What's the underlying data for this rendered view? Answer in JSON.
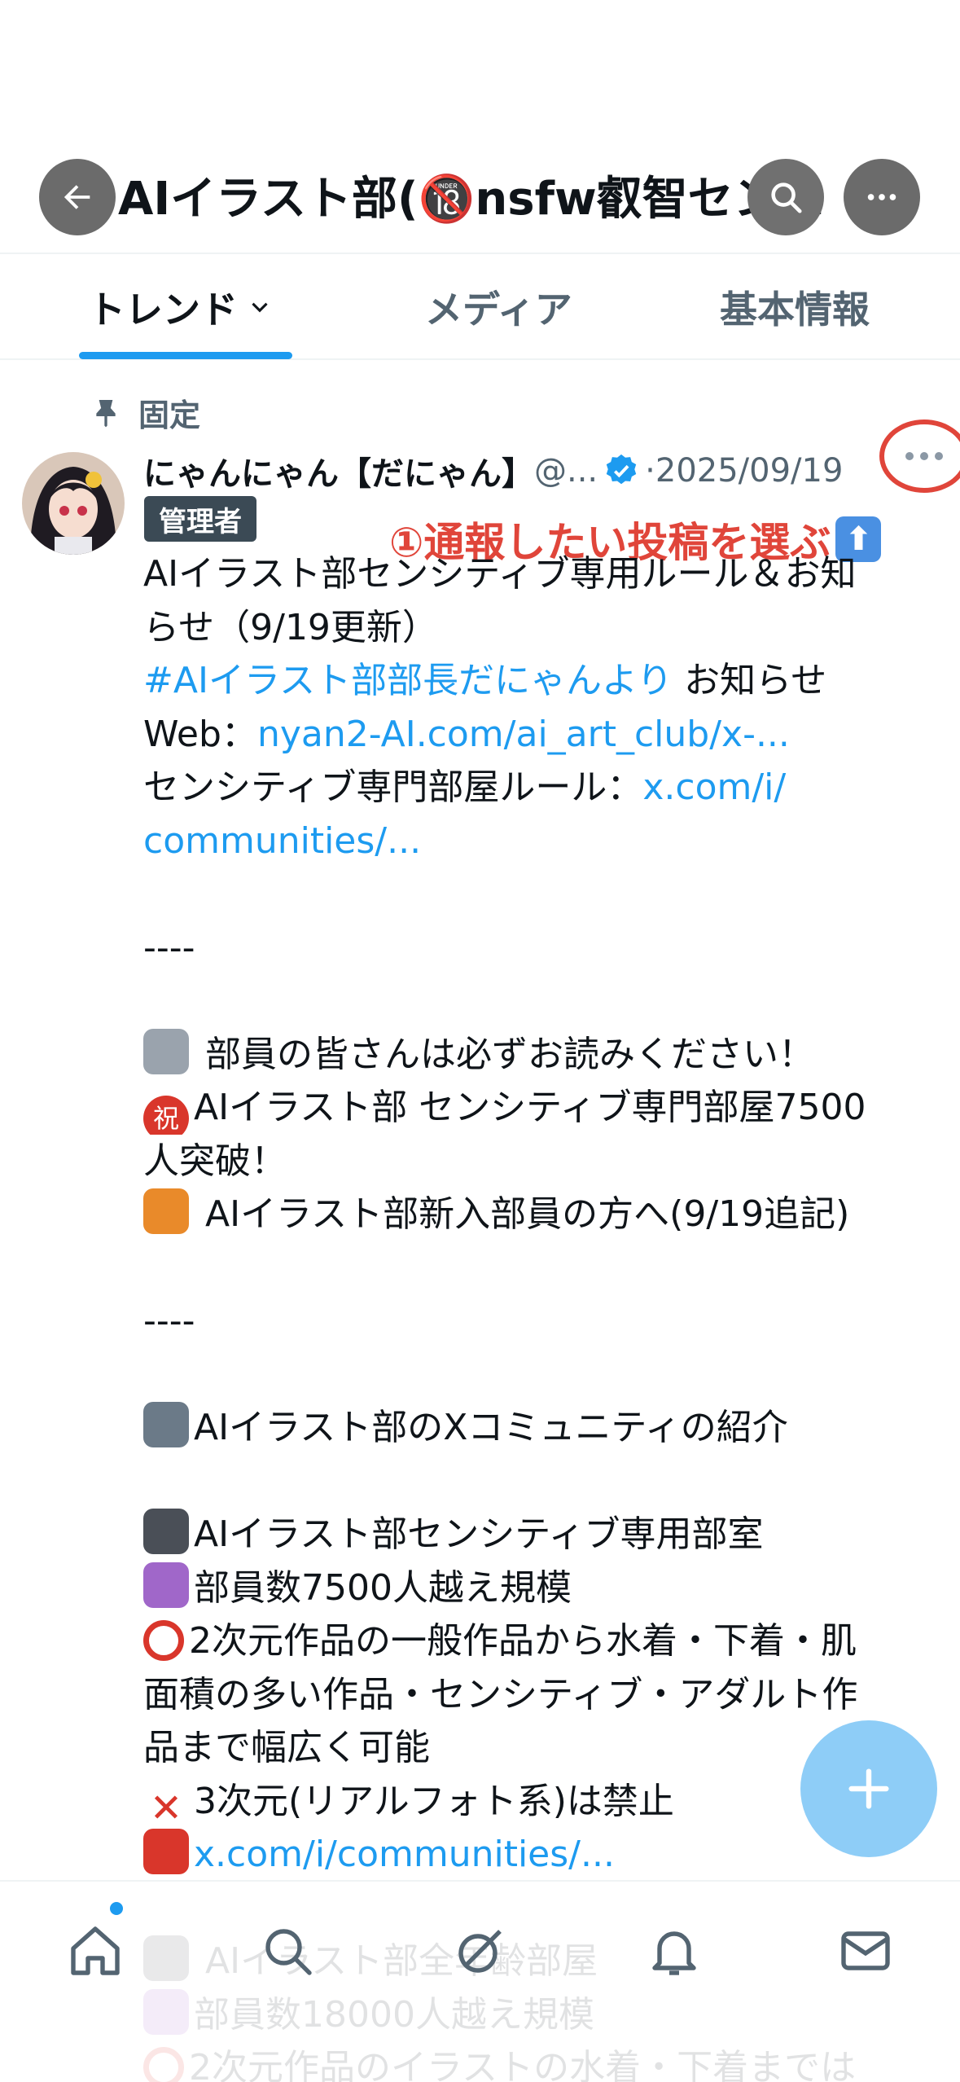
{
  "header": {
    "title": "AIイラスト部(🔞nsfw叡智セン…",
    "back_icon": "arrow-left-icon",
    "search_icon": "search-icon",
    "more_icon": "more-horizontal-icon"
  },
  "tabs": [
    {
      "label": "トレンド",
      "active": true,
      "has_dropdown": true
    },
    {
      "label": "メディア",
      "active": false
    },
    {
      "label": "基本情報",
      "active": false
    }
  ],
  "post": {
    "pinned_label": "固定",
    "author_name": "にゃんにゃん【だにゃん】",
    "author_handle": "@...",
    "separator": "·",
    "date": "2025/09/19",
    "badge": "管理者",
    "annotation": "①通報したい投稿を選ぶ",
    "lines": [
      {
        "parts": [
          {
            "t": "AIイラスト部センシティブ専用ルール＆お知"
          }
        ]
      },
      {
        "parts": [
          {
            "t": "らせ（9/19更新）"
          }
        ]
      },
      {
        "parts": [
          {
            "t": "#AIイラスト部部長だにゃんより",
            "link": true
          },
          {
            "t": " お知らせ"
          }
        ]
      },
      {
        "parts": [
          {
            "t": "Web："
          },
          {
            "t": "nyan2-AI.com/ai_art_club/x-...",
            "link": true
          }
        ]
      },
      {
        "parts": [
          {
            "t": "センシティブ専門部屋ルール："
          },
          {
            "t": "x.com/i/",
            "link": true
          }
        ]
      },
      {
        "parts": [
          {
            "t": "communities/...",
            "link": true
          }
        ]
      },
      {
        "parts": []
      },
      {
        "parts": [
          {
            "t": "----"
          }
        ]
      },
      {
        "parts": []
      },
      {
        "emoji": "📢",
        "parts": [
          {
            "t": " 部員の皆さんは必ずお読みください！"
          }
        ]
      },
      {
        "emoji": "㊗",
        "parts": [
          {
            "t": "AIイラスト部 センシティブ専門部屋7500"
          }
        ]
      },
      {
        "parts": [
          {
            "t": "人突破！"
          }
        ]
      },
      {
        "emoji": "💐",
        "parts": [
          {
            "t": " AIイラスト部新入部員の方へ(9/19追記)"
          }
        ]
      },
      {
        "parts": []
      },
      {
        "parts": [
          {
            "t": "----"
          }
        ]
      },
      {
        "parts": []
      },
      {
        "emoji": "👨‍💻",
        "parts": [
          {
            "t": "AIイラスト部のXコミュニティの紹介"
          }
        ]
      },
      {
        "parts": []
      },
      {
        "emoji": "📺",
        "parts": [
          {
            "t": "AIイラスト部センシティブ専用部室"
          }
        ]
      },
      {
        "emoji": "💟",
        "parts": [
          {
            "t": "部員数7500人越え規模"
          }
        ]
      },
      {
        "emoji": "⭕",
        "parts": [
          {
            "t": "2次元作品の一般作品から水着・下着・肌"
          }
        ]
      },
      {
        "parts": [
          {
            "t": "面積の多い作品・センシティブ・アダルト作"
          }
        ]
      },
      {
        "parts": [
          {
            "t": "品まで幅広く可能"
          }
        ]
      },
      {
        "emoji": "❌",
        "parts": [
          {
            "t": "3次元(リアルフォト系)は禁止"
          }
        ]
      },
      {
        "emoji": "📍",
        "parts": [
          {
            "t": "x.com/i/communities/...",
            "link": true
          }
        ]
      },
      {
        "parts": []
      },
      {
        "emoji": "📺",
        "parts": [
          {
            "t": " AIイラスト部全年齢部屋"
          }
        ]
      },
      {
        "emoji": "💟",
        "parts": [
          {
            "t": "部員数18000人越え規模"
          }
        ]
      },
      {
        "emoji": "⭕",
        "parts": [
          {
            "t": "2次元作品のイラストの水着・下着までは"
          }
        ]
      }
    ]
  },
  "fab_icon": "plus-icon",
  "bottom_nav": [
    {
      "icon": "home-icon",
      "has_dot": true
    },
    {
      "icon": "search-icon"
    },
    {
      "icon": "grok-icon"
    },
    {
      "icon": "bell-icon"
    },
    {
      "icon": "mail-icon"
    }
  ],
  "colors": {
    "accent": "#1d9bf0",
    "annotation": "#e0453a",
    "badge_bg": "#3b4a55",
    "fab": "#8ecdf7"
  }
}
